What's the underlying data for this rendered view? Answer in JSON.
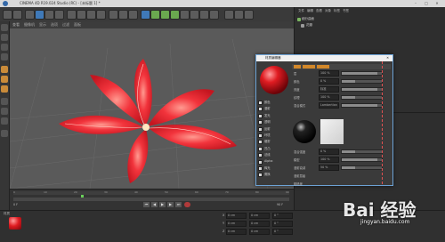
{
  "window": {
    "title": "CINEMA 4D R19.024 Studio (RC) - [未标题 1] *",
    "controls": [
      "–",
      "□",
      "✕"
    ]
  },
  "viewport": {
    "menu": [
      "查看",
      "摄像机",
      "显示",
      "选项",
      "过滤",
      "面板"
    ]
  },
  "material_dialog": {
    "title": "材质编辑器",
    "channels": [
      "颜色",
      "漫射",
      "发光",
      "透明",
      "反射",
      "环境",
      "烟雾",
      "凹凸",
      "法线",
      "Alpha",
      "辉光",
      "置换"
    ],
    "layer_labels": [
      "层",
      "颜色",
      "亮度",
      "纹理",
      "混合模式",
      "混合强度",
      "模型",
      "漫射衰减",
      "漫射层级",
      "粗糙度"
    ],
    "values": [
      "100 %",
      "0 %",
      "标准",
      "100 %",
      "Lambertian",
      "0 %",
      "100 %",
      "50 %"
    ]
  },
  "right_panel": {
    "tabs": [
      "文件",
      "编辑",
      "查看",
      "对象",
      "标签",
      "书签"
    ],
    "objects": [
      "细分曲面",
      "花瓣"
    ],
    "attrs_header": "属性"
  },
  "bottom": {
    "material_label": "材质",
    "timeline_numbers": [
      "0",
      "10",
      "20",
      "30",
      "40",
      "50",
      "60",
      "70",
      "80",
      "90"
    ],
    "frame_start": "0 F",
    "frame_end": "90 F",
    "coord_labels": [
      "X",
      "Y",
      "Z"
    ],
    "coord_values": [
      "0 cm",
      "0 cm",
      "0 cm"
    ],
    "size_values": [
      "0 cm",
      "0 cm",
      "0 cm"
    ],
    "rot_values": [
      "0 °",
      "0 °",
      "0 °"
    ]
  },
  "watermark": {
    "logo": "Bai 经验",
    "url": "jingyan.baidu.com"
  },
  "colors": {
    "accent": "#e8333b",
    "dialog_border": "#6da3d6",
    "viewport_bg": "#5a5a5a"
  }
}
